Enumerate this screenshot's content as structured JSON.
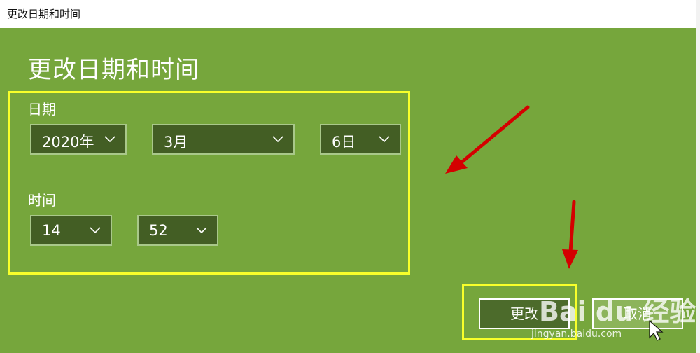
{
  "window": {
    "title": "更改日期和时间"
  },
  "heading": "更改日期和时间",
  "date": {
    "label": "日期",
    "year": "2020年",
    "month": "3月",
    "day": "6日"
  },
  "time": {
    "label": "时间",
    "hour": "14",
    "minute": "52"
  },
  "buttons": {
    "change": "更改",
    "cancel": "取消"
  },
  "watermark": {
    "brand": "Bai du 经验",
    "url": "jingyan.baidu.com"
  },
  "colors": {
    "background": "#76a63c",
    "dropdown_bg": "#435e24",
    "highlight": "#f8ff2b",
    "arrow": "#e60000"
  }
}
